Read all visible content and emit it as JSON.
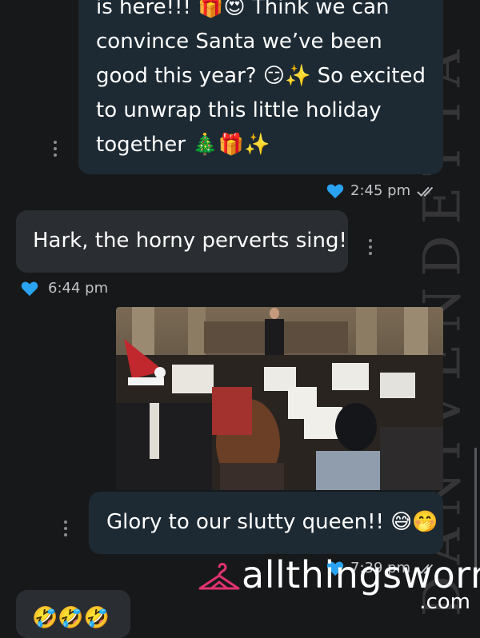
{
  "colors": {
    "background": "#17181a",
    "outgoing_bubble": "#1e2a33",
    "incoming_bubble": "#2a2d31",
    "heart": "#2aa3f2",
    "brand_pink": "#e0336e"
  },
  "messages": [
    {
      "direction": "outgoing",
      "lines": [
        "is here!!! 🎁😍 Think we can",
        "convince Santa we’ve been",
        "good this year? 😏✨ So excited",
        "to unwrap this little holiday",
        "together 🎄🎁✨"
      ],
      "time": "2:45 pm",
      "icon": "heart-icon",
      "status_icon": "double-check-icon"
    },
    {
      "direction": "incoming",
      "text": "Hark, the horny perverts sing!",
      "time": "6:44 pm",
      "icon": "heart-icon"
    },
    {
      "direction": "outgoing",
      "type": "image",
      "image_description": "choir-photo"
    },
    {
      "direction": "outgoing",
      "text": "Glory to our slutty queen!! 😅🤭",
      "time": "7:39 pm",
      "icon": "heart-icon",
      "status_icon": "double-check-icon"
    },
    {
      "direction": "incoming",
      "text": "🤣🤣🤣"
    }
  ],
  "watermark": "DANIVENDETTA",
  "brand": {
    "name": "allthingsworn",
    "suffix": ".com",
    "icon": "hanger-icon"
  }
}
